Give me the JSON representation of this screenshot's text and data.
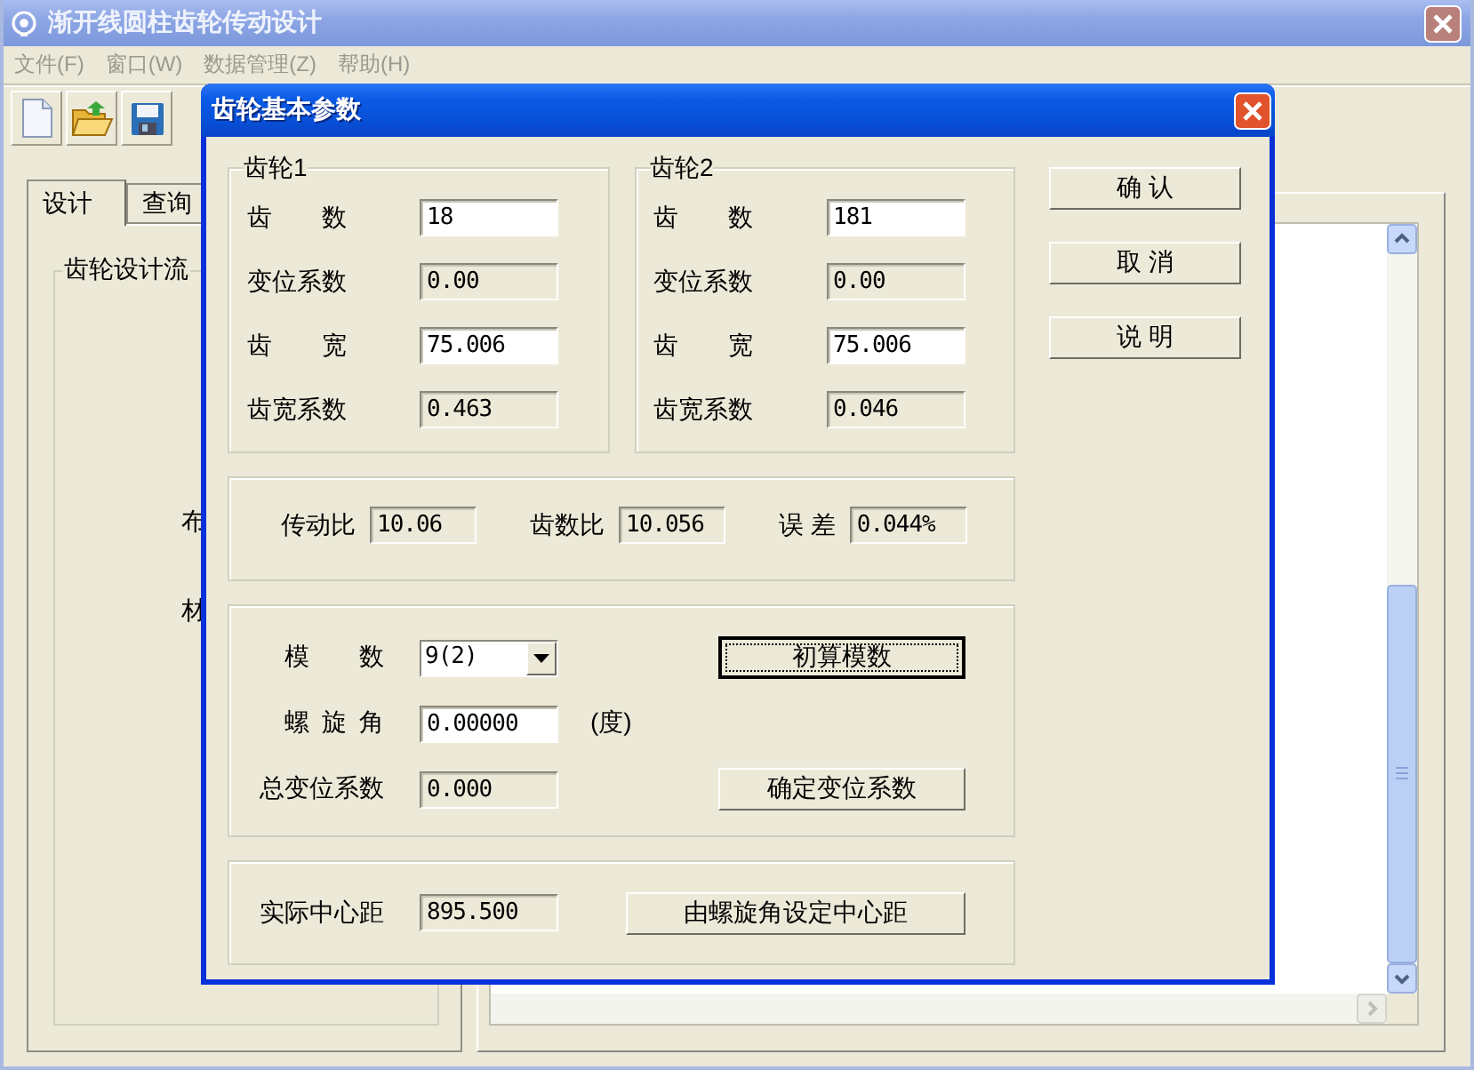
{
  "window": {
    "title": "渐开线圆柱齿轮传动设计"
  },
  "menu": [
    {
      "label": "文件(F)"
    },
    {
      "label": "窗口(W)"
    },
    {
      "label": "数据管理(Z)"
    },
    {
      "label": "帮助(H)"
    }
  ],
  "tabs": [
    {
      "label": "设计",
      "selected": true
    },
    {
      "label": "查询",
      "selected": false
    }
  ],
  "design_flow": {
    "title": "齿轮设计流",
    "steps": [
      "布",
      "材"
    ]
  },
  "dialog": {
    "title": "齿轮基本参数",
    "gears": [
      {
        "title": "齿轮1",
        "fields": [
          {
            "label": "齿 数",
            "value": "18",
            "editable": true
          },
          {
            "label": "变位系数",
            "value": "0.00",
            "editable": false
          },
          {
            "label": "齿 宽",
            "value": "75.006",
            "editable": true
          },
          {
            "label": "齿宽系数",
            "value": "0.463",
            "editable": false
          }
        ]
      },
      {
        "title": "齿轮2",
        "fields": [
          {
            "label": "齿 数",
            "value": "181",
            "editable": true
          },
          {
            "label": "变位系数",
            "value": "0.00",
            "editable": false
          },
          {
            "label": "齿 宽",
            "value": "75.006",
            "editable": true
          },
          {
            "label": "齿宽系数",
            "value": "0.046",
            "editable": false
          }
        ]
      }
    ],
    "ratios": [
      {
        "label": "传动比",
        "value": "10.06"
      },
      {
        "label": "齿数比",
        "value": "10.056"
      },
      {
        "label": "误 差",
        "value": "0.044%"
      }
    ],
    "module_rows": [
      {
        "kind": "select",
        "label": "模 数",
        "value": "9(2)",
        "button": {
          "label": "初算模数",
          "focused": true
        }
      },
      {
        "kind": "input",
        "label": "螺 旋 角",
        "value": "0.00000",
        "editable": true,
        "unit": "(度)"
      },
      {
        "kind": "input",
        "label": "总变位系数",
        "value": "0.000",
        "editable": false,
        "button": {
          "label": "确定变位系数",
          "focused": false
        }
      }
    ],
    "center": {
      "label": "实际中心距",
      "value": "895.500",
      "editable": false,
      "button": {
        "label": "由螺旋角设定中心距",
        "focused": false
      }
    },
    "buttons": [
      {
        "label": "确 认"
      },
      {
        "label": "取 消"
      },
      {
        "label": "说 明"
      }
    ]
  }
}
